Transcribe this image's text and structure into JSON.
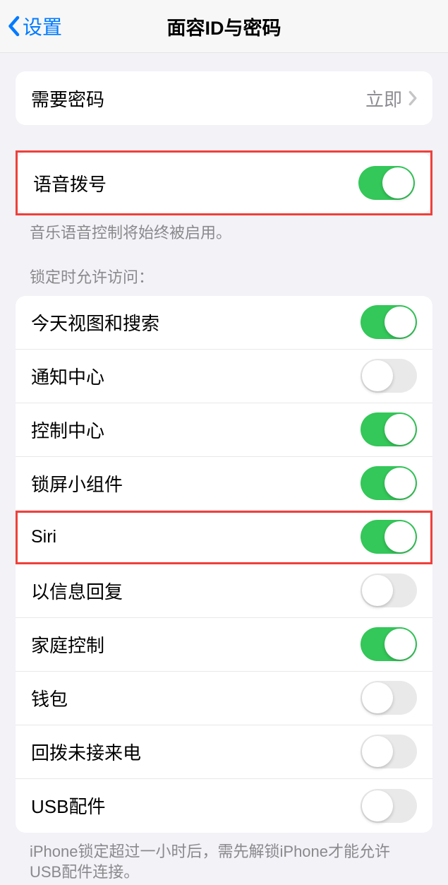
{
  "header": {
    "back_label": "设置",
    "title": "面容ID与密码"
  },
  "passcode_row": {
    "label": "需要密码",
    "value": "立即"
  },
  "voice_dial": {
    "label": "语音拨号",
    "footer": "音乐语音控制将始终被启用。",
    "on": true
  },
  "lock_section_header": "锁定时允许访问：",
  "lock_items": [
    {
      "label": "今天视图和搜索",
      "on": true
    },
    {
      "label": "通知中心",
      "on": false
    },
    {
      "label": "控制中心",
      "on": true
    },
    {
      "label": "锁屏小组件",
      "on": true
    },
    {
      "label": "Siri",
      "on": true
    },
    {
      "label": "以信息回复",
      "on": false
    },
    {
      "label": "家庭控制",
      "on": true
    },
    {
      "label": "钱包",
      "on": false
    },
    {
      "label": "回拨未接来电",
      "on": false
    },
    {
      "label": "USB配件",
      "on": false
    }
  ],
  "usb_footer": "iPhone锁定超过一小时后，需先解锁iPhone才能允许USB配件连接。"
}
